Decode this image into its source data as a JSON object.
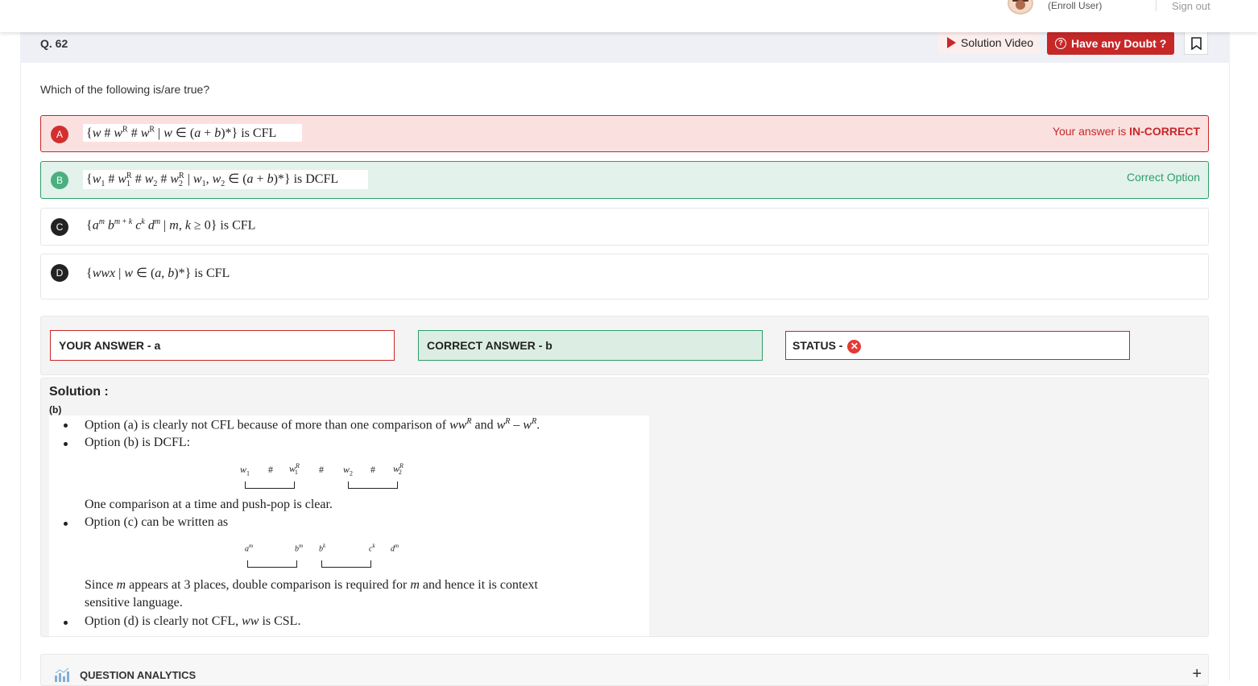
{
  "topbar": {
    "enroll_text": "(Enroll User)",
    "signout_label": "Sign out"
  },
  "question": {
    "number": "Q. 62",
    "text": "Which of the following is/are true?",
    "solution_video_label": "Solution Video",
    "doubt_label": "Have any Doubt ?"
  },
  "options": [
    {
      "letter": "A",
      "status": "wrong",
      "status_prefix": "Your answer is ",
      "status_strong": "IN-CORRECT",
      "suffix": " is CFL"
    },
    {
      "letter": "B",
      "status": "right",
      "status_text": "Correct Option",
      "suffix": " is DCFL"
    },
    {
      "letter": "C",
      "status": "none",
      "suffix": " is CFL"
    },
    {
      "letter": "D",
      "status": "none",
      "suffix": " is CFL"
    }
  ],
  "answers": {
    "your_answer": "YOUR ANSWER - a",
    "correct_answer": "CORRECT ANSWER - b",
    "status_label": "STATUS - "
  },
  "solution": {
    "title": "Solution :",
    "answer_tag": "(b)",
    "line1a": "Option (a) is clearly not CFL because of more than one comparison of ",
    "line1b": " and ",
    "line2": "Option (b) is DCFL:",
    "line3": "One comparison at a time and push-pop is clear.",
    "line4": "Option (c) can be written as",
    "line5a": "Since ",
    "line5b": " appears at 3 places, double comparison is required for ",
    "line5c": " and hence it is context",
    "line6": "sensitive language.",
    "line7a": "Option (d) is clearly not CFL, ",
    "line7b": " is CSL."
  },
  "analytics": {
    "label": "QUESTION ANALYTICS",
    "expand_symbol": "+"
  },
  "colors": {
    "brand_red": "#c62828",
    "correct_green": "#2e9d6a",
    "header_bg": "#eef0f6"
  }
}
